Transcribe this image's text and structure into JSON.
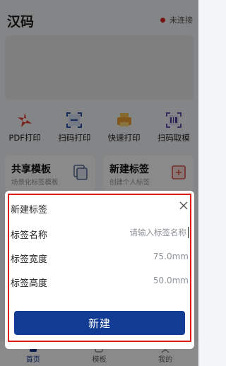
{
  "header": {
    "app_title": "汉码",
    "connection_status": "未连接",
    "status_color": "#d92323"
  },
  "quick_actions": [
    {
      "label": "PDF打印",
      "icon": "pdf-icon"
    },
    {
      "label": "扫码打印",
      "icon": "scan-icon"
    },
    {
      "label": "快速打印",
      "icon": "printer-icon"
    },
    {
      "label": "扫码取模",
      "icon": "scan-template-icon"
    }
  ],
  "cards": {
    "shared_template": {
      "title": "共享模板",
      "subtitle": "场景化标签模板"
    },
    "new_label": {
      "title": "新建标签",
      "subtitle": "创建个人标签"
    }
  },
  "tabbar": {
    "items": [
      "首页",
      "模板",
      "我的"
    ],
    "active": "首页",
    "accent": "#123b93"
  },
  "dialog": {
    "title": "新建标签",
    "name_label": "标签名称",
    "name_placeholder": "请输入标签名称",
    "width_label": "标签宽度",
    "width_value": "75.0mm",
    "height_label": "标签高度",
    "height_value": "50.0mm",
    "submit_label": "新建"
  }
}
